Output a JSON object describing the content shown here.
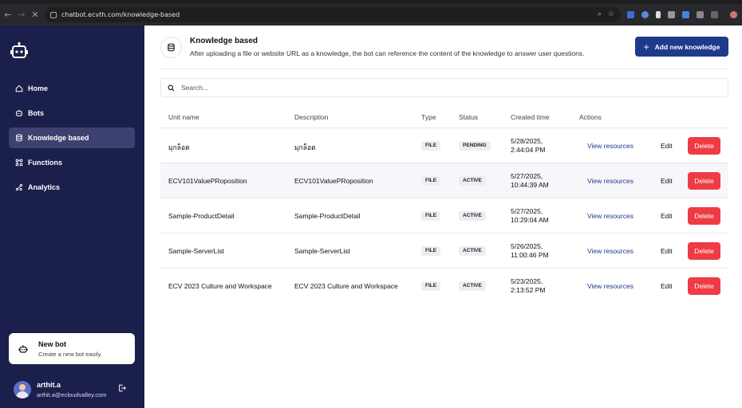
{
  "browser": {
    "url": "chatbot.ecvth.com/knowledge-based"
  },
  "sidebar": {
    "items": [
      {
        "label": "Home",
        "icon": "home-icon"
      },
      {
        "label": "Bots",
        "icon": "bot-icon"
      },
      {
        "label": "Knowledge based",
        "icon": "database-icon",
        "active": true
      },
      {
        "label": "Functions",
        "icon": "functions-icon"
      },
      {
        "label": "Analytics",
        "icon": "analytics-icon"
      }
    ],
    "new_bot": {
      "title": "New bot",
      "subtitle": "Create a new bot easily."
    },
    "user": {
      "name": "arthit.a",
      "email": "arthit.a@ecloudvalley.com"
    }
  },
  "header": {
    "title": "Knowledge based",
    "description": "After uploading a file or website URL as a knowledge, the bot can reference the content of the knowledge to answer user questions.",
    "add_button": "Add new knowledge"
  },
  "search": {
    "placeholder": "Search..."
  },
  "table": {
    "columns": {
      "unit_name": "Unit name",
      "description": "Description",
      "type": "Type",
      "status": "Status",
      "created": "Created time",
      "actions": "Actions"
    },
    "rows": [
      {
        "name": "มุกล็อต",
        "description": "มุกล็อต",
        "type": "FILE",
        "status": "PENDING",
        "date": "5/28/2025,",
        "time": "2:44:04 PM"
      },
      {
        "name": "ECV101ValuePRoposition",
        "description": "ECV101ValuePRoposition",
        "type": "FILE",
        "status": "ACTIVE",
        "date": "5/27/2025,",
        "time": "10:44:39 AM"
      },
      {
        "name": "Sample-ProductDetail",
        "description": "Sample-ProductDetail",
        "type": "FILE",
        "status": "ACTIVE",
        "date": "5/27/2025,",
        "time": "10:29:04 AM"
      },
      {
        "name": "Sample-ServerList",
        "description": "Sample-ServerList",
        "type": "FILE",
        "status": "ACTIVE",
        "date": "5/26/2025,",
        "time": "11:00:46 PM"
      },
      {
        "name": "ECV 2023 Culture and Workspace",
        "description": "ECV 2023 Culture and Workspace",
        "type": "FILE",
        "status": "ACTIVE",
        "date": "5/23/2025,",
        "time": "2:13:52 PM"
      }
    ],
    "actions": {
      "view": "View resources",
      "edit": "Edit",
      "delete": "Delete"
    }
  },
  "colors": {
    "sidebar_bg": "#1b1f4b",
    "sidebar_active": "#3c4170",
    "primary": "#1e3a8a",
    "danger": "#ef3b45"
  }
}
